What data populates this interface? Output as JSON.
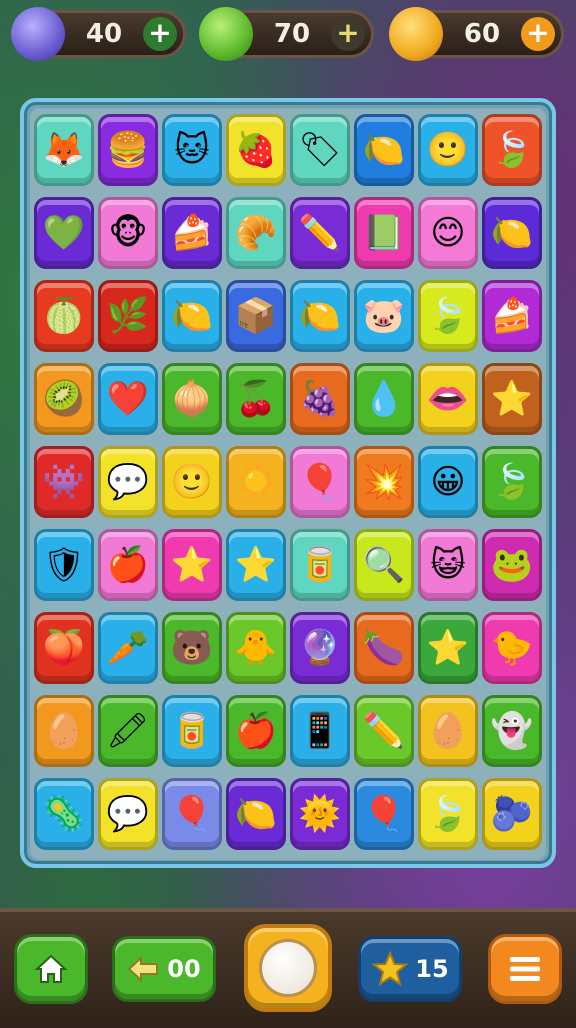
{
  "resources": [
    {
      "icon": "purple-gem-icon",
      "value": "40",
      "action": "+",
      "color": "#7b6fd6",
      "button_color": "#2f7a2f"
    },
    {
      "icon": "green-leaf-icon",
      "value": "70",
      "action": "+",
      "color": "#6ab83a",
      "button_color": "#3d3a2c"
    },
    {
      "icon": "gold-coin-icon",
      "value": "60",
      "action": "+",
      "color": "#f0a81e",
      "button_color": "#f29a1c"
    }
  ],
  "grid": {
    "rows": 9,
    "cols": 8,
    "tiles": [
      [
        {
          "c": "#5fd6c0",
          "g": "🦊",
          "n": "fox-face-icon"
        },
        {
          "c": "#8a2be2",
          "g": "🍔",
          "n": "burger-icon"
        },
        {
          "c": "#2ab0e8",
          "g": "🐱",
          "n": "cat-face-icon"
        },
        {
          "c": "#f3e22a",
          "g": "🍓",
          "n": "strawberry-icon"
        },
        {
          "c": "#5fd6c0",
          "g": "🏷",
          "n": "tag-icon"
        },
        {
          "c": "#1f7ee0",
          "g": "🍋",
          "n": "lemon-slices-icon"
        },
        {
          "c": "#2ab0e8",
          "g": "🙂",
          "n": "smile-face-icon"
        },
        {
          "c": "#f0522a",
          "g": "🍃",
          "n": "leaf-icon"
        }
      ],
      [
        {
          "c": "#6a2bd6",
          "g": "💚",
          "n": "green-heart-icon"
        },
        {
          "c": "#f07ad6",
          "g": "🐵",
          "n": "monkey-face-icon"
        },
        {
          "c": "#6a2bd6",
          "g": "🍰",
          "n": "cake-slice-icon"
        },
        {
          "c": "#5fd6c0",
          "g": "🥐",
          "n": "croissant-icon"
        },
        {
          "c": "#7a2bd6",
          "g": "✏️",
          "n": "pencil-icon"
        },
        {
          "c": "#f03ab0",
          "g": "📗",
          "n": "green-book-icon"
        },
        {
          "c": "#f47ad6",
          "g": "😊",
          "n": "happy-face-icon"
        },
        {
          "c": "#5a2bd6",
          "g": "🍋",
          "n": "lemon-drop-icon"
        }
      ],
      [
        {
          "c": "#e83a1e",
          "g": "🍈",
          "n": "lime-icon"
        },
        {
          "c": "#d8281e",
          "g": "🌿",
          "n": "herb-leaf-icon"
        },
        {
          "c": "#2ab0e8",
          "g": "🍋",
          "n": "lemon-icon"
        },
        {
          "c": "#3a6ae0",
          "g": "📦",
          "n": "gift-box-icon"
        },
        {
          "c": "#2ab0e8",
          "g": "🍋",
          "n": "yellow-fruit-icon"
        },
        {
          "c": "#2ab0e8",
          "g": "🐷",
          "n": "pig-face-icon"
        },
        {
          "c": "#d6ea1e",
          "g": "🍃",
          "n": "round-leaf-icon"
        },
        {
          "c": "#b02ad6",
          "g": "🍰",
          "n": "layer-cake-icon"
        }
      ],
      [
        {
          "c": "#f2981e",
          "g": "🥝",
          "n": "kiwi-icon"
        },
        {
          "c": "#2ab0e8",
          "g": "❤️",
          "n": "heart-icon"
        },
        {
          "c": "#4ab82a",
          "g": "🧅",
          "n": "onion-icon"
        },
        {
          "c": "#4ab82a",
          "g": "🍒",
          "n": "cherry-icon"
        },
        {
          "c": "#e86a1e",
          "g": "🍇",
          "n": "plum-icon"
        },
        {
          "c": "#4ab82a",
          "g": "💧",
          "n": "blue-drop-icon"
        },
        {
          "c": "#f3d21e",
          "g": "👄",
          "n": "lips-icon"
        },
        {
          "c": "#c0621e",
          "g": "⭐",
          "n": "star-icon"
        }
      ],
      [
        {
          "c": "#e02a2a",
          "g": "👾",
          "n": "purple-blob-icon"
        },
        {
          "c": "#f3e22a",
          "g": "💬",
          "n": "speech-bubble-icon"
        },
        {
          "c": "#f3d21e",
          "g": "🙂",
          "n": "orange-face-icon"
        },
        {
          "c": "#f3b21e",
          "g": "☀️",
          "n": "sun-face-icon"
        },
        {
          "c": "#f07ad6",
          "g": "🎈",
          "n": "balloon-icon"
        },
        {
          "c": "#f07a1e",
          "g": "💥",
          "n": "burst-icon"
        },
        {
          "c": "#2ab0e8",
          "g": "😀",
          "n": "grin-face-icon"
        },
        {
          "c": "#4ab82a",
          "g": "🍃",
          "n": "dark-leaf-icon"
        }
      ],
      [
        {
          "c": "#2ab0e8",
          "g": "🛡",
          "n": "shield-icon"
        },
        {
          "c": "#f07ad6",
          "g": "🍎",
          "n": "apple-icon"
        },
        {
          "c": "#f03ab0",
          "g": "⭐",
          "n": "blue-star-icon"
        },
        {
          "c": "#2ab0e8",
          "g": "⭐",
          "n": "gold-star-icon"
        },
        {
          "c": "#5fd6c0",
          "g": "🥫",
          "n": "jar-icon"
        },
        {
          "c": "#c8e81e",
          "g": "🔍",
          "n": "magnifier-icon"
        },
        {
          "c": "#f07ad6",
          "g": "😺",
          "n": "kitten-face-icon"
        },
        {
          "c": "#d02ab0",
          "g": "🐸",
          "n": "frog-face-icon"
        }
      ],
      [
        {
          "c": "#e0321e",
          "g": "🍑",
          "n": "peach-icon"
        },
        {
          "c": "#2ab0e8",
          "g": "🥕",
          "n": "carrot-icon"
        },
        {
          "c": "#4ab82a",
          "g": "🐻",
          "n": "bear-face-icon"
        },
        {
          "c": "#6ac82a",
          "g": "🐥",
          "n": "chick-face-icon"
        },
        {
          "c": "#7a2bd6",
          "g": "🔮",
          "n": "orb-icon"
        },
        {
          "c": "#e86a1e",
          "g": "🍆",
          "n": "eggplant-icon"
        },
        {
          "c": "#3aa83a",
          "g": "⭐",
          "n": "bright-star-icon"
        },
        {
          "c": "#f03ab0",
          "g": "🐤",
          "n": "bird-icon"
        }
      ],
      [
        {
          "c": "#f2981e",
          "g": "🥚",
          "n": "egg-face-icon"
        },
        {
          "c": "#4ab82a",
          "g": "🖍",
          "n": "crayon-icon"
        },
        {
          "c": "#2ab0e8",
          "g": "🥫",
          "n": "can-icon"
        },
        {
          "c": "#4ab82a",
          "g": "🍎",
          "n": "red-apple-icon"
        },
        {
          "c": "#2ab0e8",
          "g": "📱",
          "n": "phone-icon"
        },
        {
          "c": "#6ac82a",
          "g": "✏️",
          "n": "purple-pencil-icon"
        },
        {
          "c": "#f3c21e",
          "g": "🥚",
          "n": "orange-egg-icon"
        },
        {
          "c": "#4ab82a",
          "g": "👻",
          "n": "ghost-icon"
        }
      ],
      [
        {
          "c": "#2ab0e8",
          "g": "🦠",
          "n": "germ-icon"
        },
        {
          "c": "#f3e22a",
          "g": "💬",
          "n": "chat-bubble-icon"
        },
        {
          "c": "#7a8ae8",
          "g": "🎈",
          "n": "pink-balloon-icon"
        },
        {
          "c": "#6a2bd6",
          "g": "🍋",
          "n": "yellow-lemon-icon"
        },
        {
          "c": "#7a2bd6",
          "g": "🌞",
          "n": "bright-sun-icon"
        },
        {
          "c": "#2a8ae0",
          "g": "🎈",
          "n": "blue-balloon-icon"
        },
        {
          "c": "#f3e22a",
          "g": "🍃",
          "n": "green-leaf-tile-icon"
        },
        {
          "c": "#f3d21e",
          "g": "🫐",
          "n": "dark-berry-icon"
        }
      ]
    ]
  },
  "toolbar": {
    "home": {
      "icon": "home-icon",
      "color": "#4ab82a"
    },
    "undo": {
      "icon": "undo-arrow-icon",
      "value": "00",
      "color": "#4ab82a"
    },
    "center": {
      "icon": "circle-button-icon",
      "color": "#f3b21e"
    },
    "stars": {
      "icon": "star-icon",
      "value": "15",
      "color": "#1f5fa0"
    },
    "menu": {
      "icon": "menu-icon",
      "color": "#f2881e"
    }
  }
}
